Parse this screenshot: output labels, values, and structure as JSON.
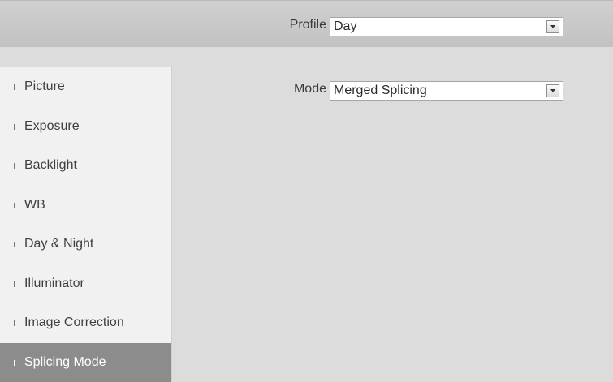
{
  "header": {
    "profile_label": "Profile",
    "profile_value": "Day"
  },
  "sidebar": {
    "items": [
      {
        "label": "Picture",
        "active": false
      },
      {
        "label": "Exposure",
        "active": false
      },
      {
        "label": "Backlight",
        "active": false
      },
      {
        "label": "WB",
        "active": false
      },
      {
        "label": "Day & Night",
        "active": false
      },
      {
        "label": "Illuminator",
        "active": false
      },
      {
        "label": "Image Correction",
        "active": false
      },
      {
        "label": "Splicing Mode",
        "active": true
      }
    ]
  },
  "main": {
    "mode_label": "Mode",
    "mode_value": "Merged Splicing"
  },
  "icons": {
    "dropdown": "chevron-down-icon",
    "bullet": "bullet-icon"
  },
  "colors": {
    "active_item_bg": "#8c8c8c",
    "content_bg": "#dcdcdc",
    "sidebar_bg": "#f1f1f1",
    "header_bg": "#c8c8c8"
  }
}
